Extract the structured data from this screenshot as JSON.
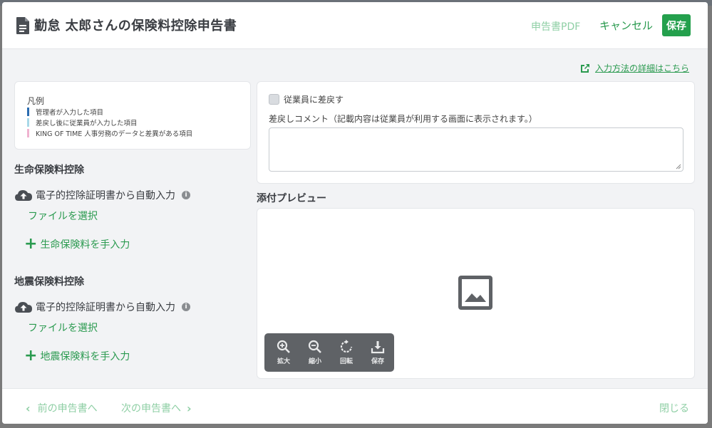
{
  "header": {
    "title": "勤怠 太郎さんの保険料控除申告書",
    "pdf_label": "申告書PDF",
    "cancel_label": "キャンセル",
    "save_label": "保存"
  },
  "detail_link": "入力方法の詳細はこちら",
  "legend": {
    "title": "凡例",
    "items": [
      {
        "label": "管理者が入力した項目",
        "color": "#2b6cb0"
      },
      {
        "label": "差戻し後に従業員が入力した項目",
        "color": "#a8d8e8"
      },
      {
        "label": "KING OF TIME 人事労務のデータと差異がある項目",
        "color": "#f0b3d0"
      }
    ]
  },
  "sections": [
    {
      "title": "生命保険料控除",
      "auto_input": "電子的控除証明書から自動入力",
      "file_select": "ファイルを選択",
      "manual": "生命保険料を手入力"
    },
    {
      "title": "地震保険料控除",
      "auto_input": "電子的控除証明書から自動入力",
      "file_select": "ファイルを選択",
      "manual": "地震保険料を手入力"
    }
  ],
  "return_panel": {
    "checkbox_label": "従業員に差戻す",
    "comment_label": "差戻しコメント（記載内容は従業員が利用する画面に表示されます。）",
    "comment_value": ""
  },
  "preview": {
    "title": "添付プレビュー",
    "tools": [
      {
        "label": "拡大",
        "icon": "zoom-in-icon"
      },
      {
        "label": "縮小",
        "icon": "zoom-out-icon"
      },
      {
        "label": "回転",
        "icon": "rotate-icon"
      },
      {
        "label": "保存",
        "icon": "download-icon"
      }
    ]
  },
  "footer": {
    "prev_label": "前の申告書へ",
    "next_label": "次の申告書へ",
    "close_label": "閉じる"
  },
  "colors": {
    "accent": "#24a04d",
    "link": "#2a9a4f",
    "disabled_link": "#8fcfa5"
  }
}
